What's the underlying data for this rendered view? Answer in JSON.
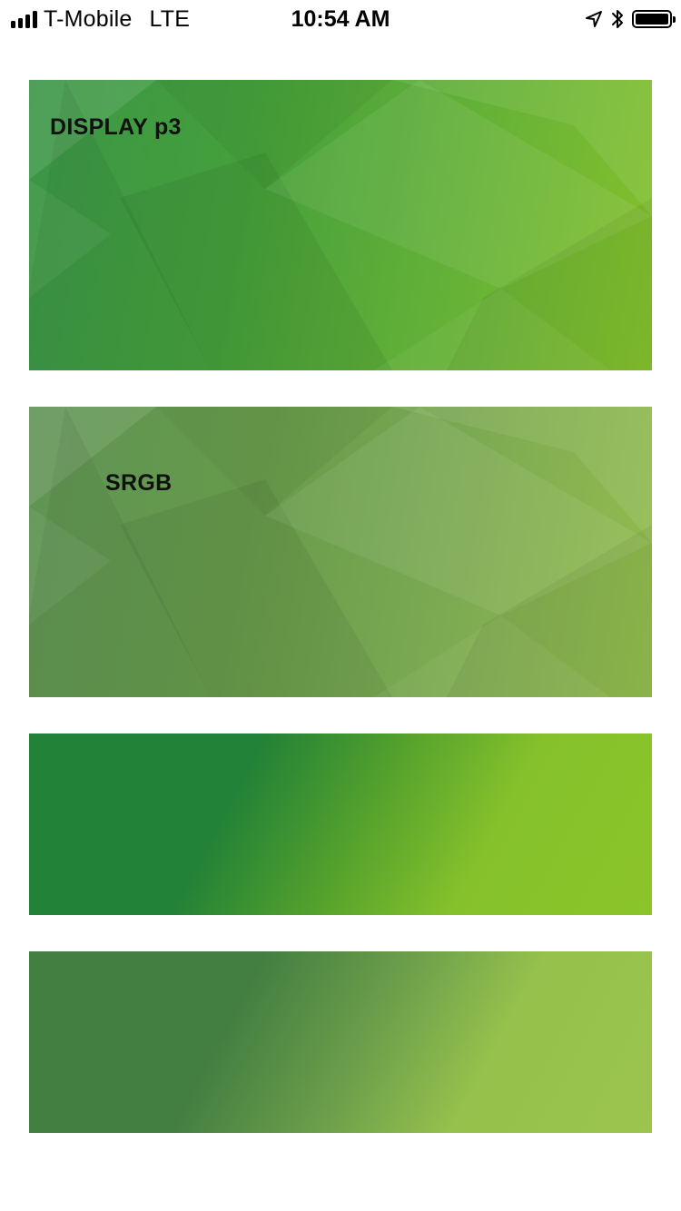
{
  "status_bar": {
    "carrier": "T-Mobile",
    "network": "LTE",
    "time": "10:54 AM",
    "icons": [
      "signal-icon",
      "location-arrow-icon",
      "bluetooth-icon",
      "battery-icon"
    ],
    "battery_level": 1.0
  },
  "panels": [
    {
      "label": "DISPLAY p3",
      "colors": [
        "#3b9548",
        "#84c12d"
      ]
    },
    {
      "label": "SRGB",
      "colors": [
        "#5f9456",
        "#93bd4f"
      ]
    },
    {
      "label": "",
      "colors": [
        "#228237",
        "#8bc52a"
      ]
    },
    {
      "label": "",
      "colors": [
        "#447f42",
        "#9bc54d"
      ]
    }
  ]
}
